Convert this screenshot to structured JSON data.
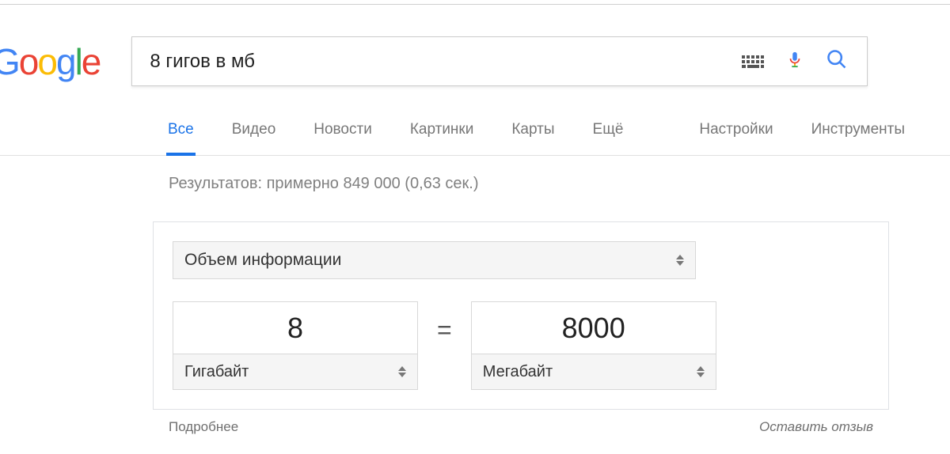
{
  "colors": {
    "google_blue": "#4285F4",
    "google_red": "#EA4335",
    "google_yellow": "#FBBC05",
    "google_green": "#34A853",
    "accent_blue": "#1a73e8"
  },
  "logo": {
    "text": "Google"
  },
  "search": {
    "query": "8 гигов в мб",
    "keyboard_icon": "keyboard-icon",
    "mic_icon": "mic-icon",
    "search_icon": "search-icon"
  },
  "tabs": {
    "items": [
      "Все",
      "Видео",
      "Новости",
      "Картинки",
      "Карты",
      "Ещё"
    ],
    "active_index": 0,
    "right_items": [
      "Настройки",
      "Инструменты"
    ]
  },
  "results": {
    "stats": "Результатов: примерно 849 000 (0,63 сек.)"
  },
  "converter": {
    "category": "Объем информации",
    "left_value": "8",
    "left_unit": "Гигабайт",
    "equals": "=",
    "right_value": "8000",
    "right_unit": "Мегабайт"
  },
  "footer": {
    "more": "Подробнее",
    "feedback": "Оставить отзыв"
  }
}
